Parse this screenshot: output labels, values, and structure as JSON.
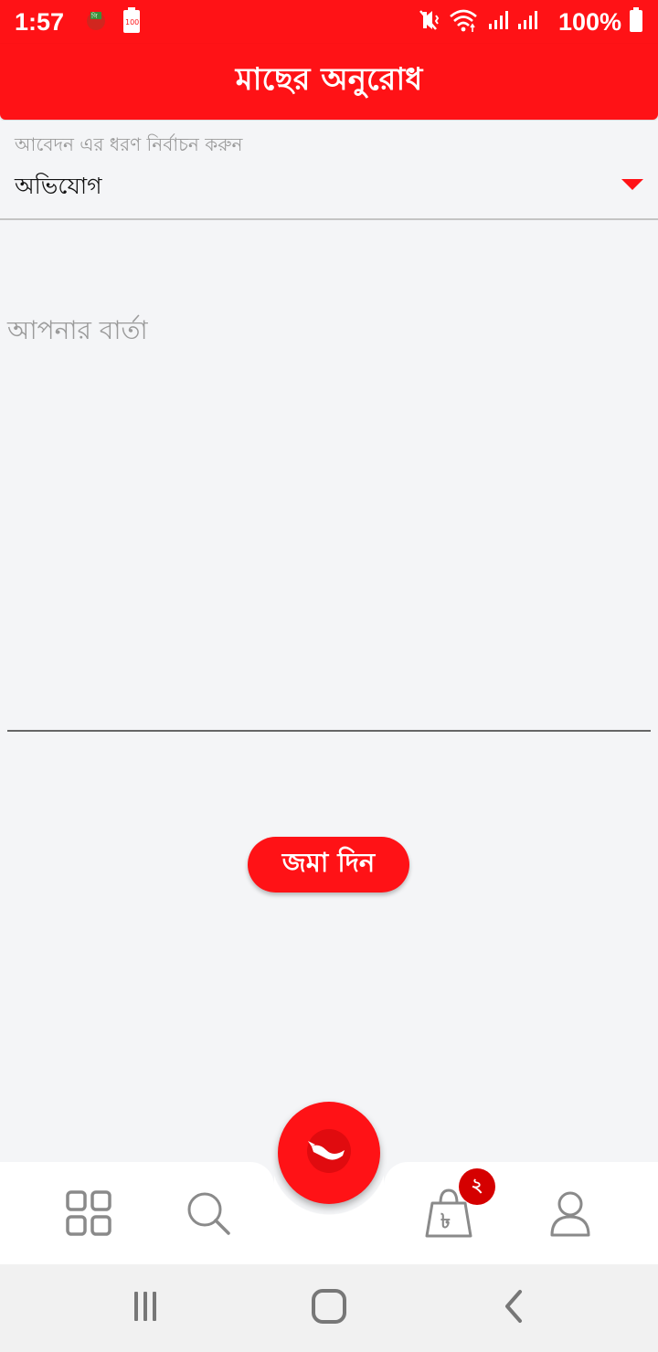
{
  "status_bar": {
    "time": "1:57",
    "battery_percent_text": "100%",
    "left_icons": [
      "gift-app-icon",
      "battery-100-icon"
    ],
    "right_icons": [
      "mute-vibrate-icon",
      "wifi-icon",
      "signal-icon",
      "signal-icon",
      "battery-icon"
    ],
    "background": "#ff1216"
  },
  "app_bar": {
    "title": "মাছের অনুরোধ",
    "background": "#ff1216"
  },
  "request_type": {
    "label": "আবেদন এর ধরণ নির্বাচন করুন",
    "value": "অভিযোগ",
    "arrow_icon": "triangle-down-icon"
  },
  "message": {
    "placeholder": "আপনার বার্তা",
    "value": ""
  },
  "submit": {
    "label": "জমা দিন"
  },
  "bottom_nav": {
    "items": [
      {
        "icon": "grid-icon"
      },
      {
        "icon": "search-icon"
      },
      {
        "icon": "fish-icon"
      },
      {
        "icon": "shopping-bag-taka-icon"
      },
      {
        "icon": "user-icon"
      }
    ],
    "cart_badge": "২"
  },
  "system_nav": {
    "items": [
      "recent-apps-icon",
      "home-icon",
      "back-icon"
    ]
  },
  "colors": {
    "accent": "#ff1216",
    "badge": "#d50000",
    "page_background": "#f4f5f7"
  }
}
